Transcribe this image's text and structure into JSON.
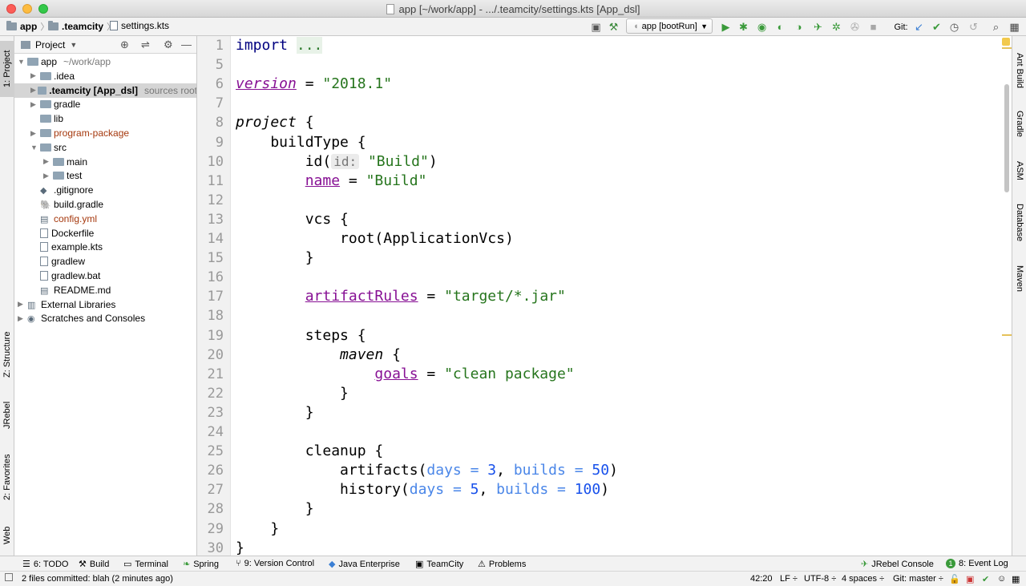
{
  "window": {
    "title": "app [~/work/app] - .../.teamcity/settings.kts [App_dsl]"
  },
  "breadcrumb": [
    "app",
    ".teamcity",
    "settings.kts"
  ],
  "toolbar": {
    "run_config": "app [bootRun]",
    "git_label": "Git:"
  },
  "project_panel": {
    "title": "Project",
    "tree": [
      {
        "label": "app",
        "suffix": "~/work/app",
        "indent": 0,
        "arrow": "▼",
        "icon": "folder"
      },
      {
        "label": ".idea",
        "indent": 1,
        "arrow": "▶",
        "icon": "folder"
      },
      {
        "label": ".teamcity [App_dsl]",
        "suffix": "sources root",
        "indent": 1,
        "arrow": "▶",
        "icon": "folder",
        "selected": true
      },
      {
        "label": "gradle",
        "indent": 1,
        "arrow": "▶",
        "icon": "folder"
      },
      {
        "label": "lib",
        "indent": 1,
        "arrow": "",
        "icon": "folder"
      },
      {
        "label": "program-package",
        "indent": 1,
        "arrow": "▶",
        "icon": "folder",
        "color": "#a5380d"
      },
      {
        "label": "src",
        "indent": 1,
        "arrow": "▼",
        "icon": "folder"
      },
      {
        "label": "main",
        "indent": 2,
        "arrow": "▶",
        "icon": "folder"
      },
      {
        "label": "test",
        "indent": 2,
        "arrow": "▶",
        "icon": "folder"
      },
      {
        "label": ".gitignore",
        "indent": 1,
        "arrow": "",
        "icon": "git"
      },
      {
        "label": "build.gradle",
        "indent": 1,
        "arrow": "",
        "icon": "gradle"
      },
      {
        "label": "config.yml",
        "indent": 1,
        "arrow": "",
        "icon": "table",
        "color": "#a5380d"
      },
      {
        "label": "Dockerfile",
        "indent": 1,
        "arrow": "",
        "icon": "file"
      },
      {
        "label": "example.kts",
        "indent": 1,
        "arrow": "",
        "icon": "file"
      },
      {
        "label": "gradlew",
        "indent": 1,
        "arrow": "",
        "icon": "file"
      },
      {
        "label": "gradlew.bat",
        "indent": 1,
        "arrow": "",
        "icon": "file"
      },
      {
        "label": "README.md",
        "indent": 1,
        "arrow": "",
        "icon": "md"
      },
      {
        "label": "External Libraries",
        "indent": 0,
        "arrow": "▶",
        "icon": "lib"
      },
      {
        "label": "Scratches and Consoles",
        "indent": 0,
        "arrow": "▶",
        "icon": "scratch"
      }
    ]
  },
  "left_tabs": [
    "1: Project",
    "Z: Structure",
    "JRebel",
    "2: Favorites",
    "Web"
  ],
  "right_tabs": [
    "Ant Build",
    "Gradle",
    "ASM",
    "Database",
    "Maven"
  ],
  "editor": {
    "line_numbers": [
      "1",
      "5",
      "6",
      "7",
      "8",
      "9",
      "10",
      "11",
      "12",
      "13",
      "14",
      "15",
      "16",
      "17",
      "18",
      "19",
      "20",
      "21",
      "22",
      "23",
      "24",
      "25",
      "26",
      "27",
      "28",
      "29",
      "30"
    ],
    "lines": [
      [
        {
          "t": "import",
          "c": "kw"
        },
        {
          "t": " "
        },
        {
          "t": "...",
          "c": "fold"
        }
      ],
      [],
      [
        {
          "t": "version",
          "c": "prop it"
        },
        {
          "t": " = "
        },
        {
          "t": "\"2018.1\"",
          "c": "str"
        }
      ],
      [],
      [
        {
          "t": "project",
          "c": "it"
        },
        {
          "t": " {"
        }
      ],
      [
        {
          "t": "    buildType {"
        }
      ],
      [
        {
          "t": "        id("
        },
        {
          "t": "id:",
          "c": "hint"
        },
        {
          "t": " "
        },
        {
          "t": "\"Build\"",
          "c": "str"
        },
        {
          "t": ")"
        }
      ],
      [
        {
          "t": "        "
        },
        {
          "t": "name",
          "c": "prop"
        },
        {
          "t": " = "
        },
        {
          "t": "\"Build\"",
          "c": "str"
        }
      ],
      [],
      [
        {
          "t": "        vcs {"
        }
      ],
      [
        {
          "t": "            root(ApplicationVcs)"
        }
      ],
      [
        {
          "t": "        }"
        }
      ],
      [],
      [
        {
          "t": "        "
        },
        {
          "t": "artifactRules",
          "c": "prop"
        },
        {
          "t": " = "
        },
        {
          "t": "\"target/*.jar\"",
          "c": "str"
        }
      ],
      [],
      [
        {
          "t": "        steps {"
        }
      ],
      [
        {
          "t": "            "
        },
        {
          "t": "maven",
          "c": "it"
        },
        {
          "t": " {"
        }
      ],
      [
        {
          "t": "                "
        },
        {
          "t": "goals",
          "c": "prop"
        },
        {
          "t": " = "
        },
        {
          "t": "\"clean package\"",
          "c": "str"
        }
      ],
      [
        {
          "t": "            }"
        }
      ],
      [
        {
          "t": "        }"
        }
      ],
      [],
      [
        {
          "t": "        cleanup {"
        }
      ],
      [
        {
          "t": "            artifacts("
        },
        {
          "t": "days",
          "c": "param"
        },
        {
          "t": " = ",
          "c": "param"
        },
        {
          "t": "3",
          "c": "num"
        },
        {
          "t": ", "
        },
        {
          "t": "builds",
          "c": "param"
        },
        {
          "t": " = ",
          "c": "param"
        },
        {
          "t": "50",
          "c": "num"
        },
        {
          "t": ")"
        }
      ],
      [
        {
          "t": "            history("
        },
        {
          "t": "days",
          "c": "param"
        },
        {
          "t": " = ",
          "c": "param"
        },
        {
          "t": "5",
          "c": "num"
        },
        {
          "t": ", "
        },
        {
          "t": "builds",
          "c": "param"
        },
        {
          "t": " = ",
          "c": "param"
        },
        {
          "t": "100",
          "c": "num"
        },
        {
          "t": ")"
        }
      ],
      [
        {
          "t": "        }"
        }
      ],
      [
        {
          "t": "    }"
        }
      ],
      [
        {
          "t": "}"
        }
      ]
    ]
  },
  "bottom_tools": {
    "todo": "6: TODO",
    "build": "Build",
    "terminal": "Terminal",
    "spring": "Spring",
    "vcs": "9: Version Control",
    "java_ee": "Java Enterprise",
    "teamcity": "TeamCity",
    "problems": "Problems",
    "jrebel_console": "JRebel Console",
    "event_log": "8: Event Log"
  },
  "status": {
    "message": "2 files committed: blah (2 minutes ago)",
    "position": "42:20",
    "line_sep": "LF ÷",
    "encoding": "UTF-8 ÷",
    "indent": "4 spaces ÷",
    "branch": "Git: master ÷"
  },
  "colors": {
    "string": "#26751d",
    "property": "#871094",
    "keyword": "#000080",
    "number": "#1750eb",
    "param": "#4a86e8",
    "selection": "#d5d5d5"
  }
}
